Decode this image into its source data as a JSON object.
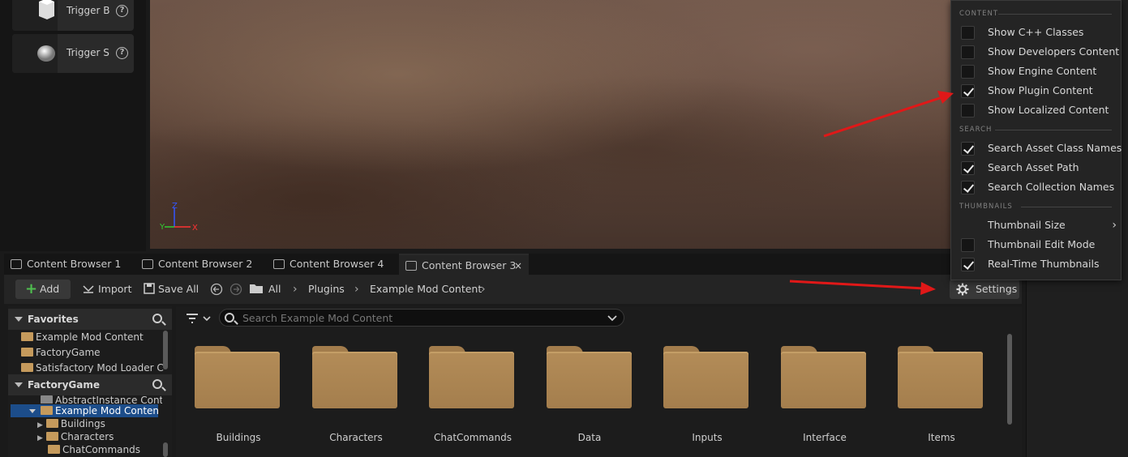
{
  "place_actors": {
    "items": [
      {
        "label": "Trigger B"
      },
      {
        "label": "Trigger S"
      }
    ]
  },
  "viewport": {
    "axis": {
      "z": "Z",
      "y": "Y",
      "x": "X"
    }
  },
  "tabs": [
    {
      "label": "Content Browser 1"
    },
    {
      "label": "Content Browser 2"
    },
    {
      "label": "Content Browser 4"
    },
    {
      "label": "Content Browser 3",
      "close": "×"
    }
  ],
  "toolbar": {
    "add_label": "Add",
    "import_label": "Import",
    "save_all_label": "Save All",
    "breadcrumb": [
      "All",
      "Plugins",
      "Example Mod Content"
    ],
    "settings_label": "Settings"
  },
  "sources": {
    "favorites_title": "Favorites",
    "favorites": [
      "Example Mod Content",
      "FactoryGame",
      "Satisfactory Mod Loader C"
    ],
    "factorygame_title": "FactoryGame",
    "tree": [
      "AbstractInstance Cont",
      "Example Mod Content",
      "Buildings",
      "Characters",
      "ChatCommands"
    ]
  },
  "search": {
    "placeholder": "Search Example Mod Content"
  },
  "folders": [
    "Buildings",
    "Characters",
    "ChatCommands",
    "Data",
    "Inputs",
    "Interface",
    "Items"
  ],
  "settings_menu": {
    "content_header": "CONTENT",
    "content_items": [
      {
        "label": "Show C++ Classes",
        "checked": false
      },
      {
        "label": "Show Developers Content",
        "checked": false
      },
      {
        "label": "Show Engine Content",
        "checked": false
      },
      {
        "label": "Show Plugin Content",
        "checked": true
      },
      {
        "label": "Show Localized Content",
        "checked": false
      }
    ],
    "search_header": "SEARCH",
    "search_items": [
      {
        "label": "Search Asset Class Names",
        "checked": true
      },
      {
        "label": "Search Asset Path",
        "checked": true
      },
      {
        "label": "Search Collection Names",
        "checked": true
      }
    ],
    "thumbnails_header": "THUMBNAILS",
    "thumbnail_size_label": "Thumbnail Size",
    "thumbnail_items": [
      {
        "label": "Thumbnail Edit Mode",
        "checked": false
      },
      {
        "label": "Real-Time Thumbnails",
        "checked": true
      }
    ]
  },
  "colors": {
    "annotation_arrow": "#e01818",
    "folder": "#b38c58",
    "add_plus": "#4fc04f"
  }
}
